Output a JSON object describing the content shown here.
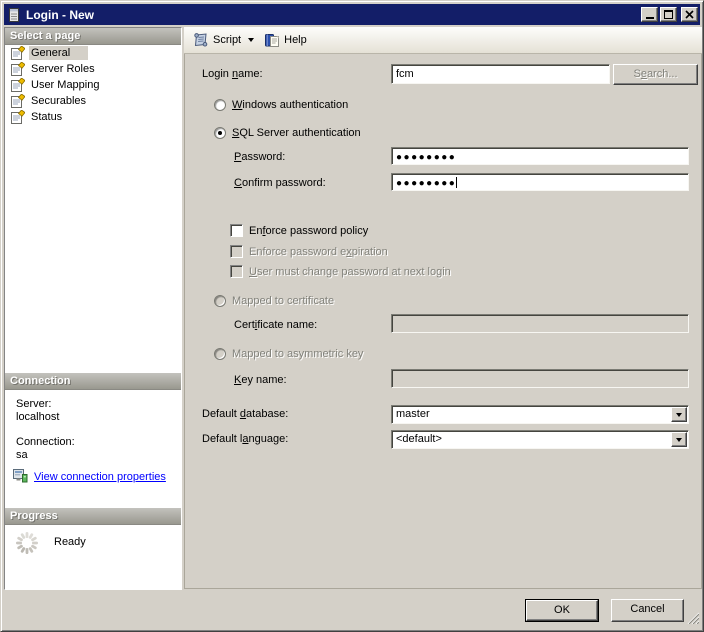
{
  "window": {
    "title": "Login - New"
  },
  "toolbar": {
    "script": "Script",
    "help": "Help"
  },
  "sidebar": {
    "select_page_header": "Select a page",
    "pages": [
      {
        "label": "General",
        "selected": true
      },
      {
        "label": "Server Roles",
        "selected": false
      },
      {
        "label": "User Mapping",
        "selected": false
      },
      {
        "label": "Securables",
        "selected": false
      },
      {
        "label": "Status",
        "selected": false
      }
    ],
    "connection_header": "Connection",
    "connection": {
      "server_label": "Server:",
      "server_value": "localhost",
      "connection_label": "Connection:",
      "connection_value": "sa",
      "link": "View connection properties"
    },
    "progress_header": "Progress",
    "progress_status": "Ready"
  },
  "form": {
    "login_name": {
      "pre": "Login ",
      "u": "n",
      "post": "ame:"
    },
    "login_value": "fcm",
    "search": {
      "pre": "S",
      "u": "e",
      "post": "arch..."
    },
    "windows_auth": {
      "pre": "",
      "u": "W",
      "post": "indows authentication"
    },
    "sql_auth": {
      "pre": "",
      "u": "S",
      "post": "QL Server authentication"
    },
    "password": {
      "pre": "",
      "u": "P",
      "post": "assword:"
    },
    "password_value": "●●●●●●●●",
    "confirm": {
      "pre": "",
      "u": "C",
      "post": "onfirm password:"
    },
    "confirm_value": "●●●●●●●●",
    "enforce_policy": {
      "pre": "En",
      "u": "f",
      "post": "orce password policy"
    },
    "enforce_expiration": {
      "pre": "Enforce password e",
      "u": "x",
      "post": "piration"
    },
    "must_change": {
      "pre": "",
      "u": "U",
      "post": "ser must change password at next login"
    },
    "mapped_cert": "Mapped to certificate",
    "cert_name": {
      "pre": "Cert",
      "u": "i",
      "post": "ficate name:"
    },
    "cert_value": "",
    "mapped_key": "Mapped to asymmetric key",
    "key_name": {
      "pre": "",
      "u": "K",
      "post": "ey name:"
    },
    "key_value": "",
    "default_db": {
      "pre": "Default ",
      "u": "d",
      "post": "atabase:"
    },
    "default_db_value": "master",
    "default_lang": {
      "pre": "Default l",
      "u": "a",
      "post": "nguage:"
    },
    "default_lang_value": "<default>"
  },
  "buttons": {
    "ok": "OK",
    "cancel": "Cancel"
  },
  "colors": {
    "titlebar": "#131e68",
    "window_face": "#d4d0c8",
    "sidebar_header_gradient": [
      "#c3c2bd",
      "#99988f"
    ],
    "link": "#0000ff",
    "disabled_text": "#82827b"
  },
  "icons": {
    "app": "server-icon",
    "titlebar": [
      "minimize-icon",
      "maximize-icon",
      "close-icon"
    ],
    "script": "scroll-icon",
    "help": "help-book-icon",
    "page": "page-edit-icon",
    "connection_link": "connection-properties-icon",
    "progress": "spinner-icon",
    "combo_arrow": "▼"
  }
}
